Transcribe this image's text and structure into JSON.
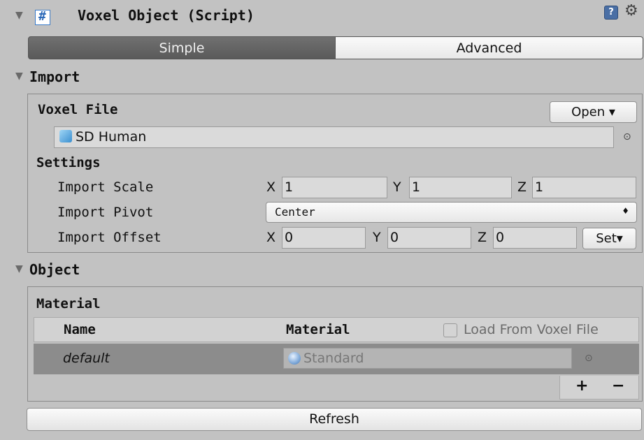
{
  "header": {
    "title": "Voxel Object (Script)",
    "collapse_glyph": "▼",
    "script_icon": "csharp-script-icon",
    "help_glyph": "?",
    "gear_glyph": "⚙"
  },
  "mode_toggle": {
    "options": [
      "Simple",
      "Advanced"
    ],
    "selected": "Simple"
  },
  "import": {
    "title": "Import",
    "collapse_glyph": "▼",
    "voxel_file": {
      "label": "Voxel File",
      "open_label": "Open ▾",
      "value": "SD Human",
      "picker_glyph": "⊙"
    },
    "settings_label": "Settings",
    "import_scale": {
      "label": "Import Scale",
      "x_label": "X",
      "x": "1",
      "y_label": "Y",
      "y": "1",
      "z_label": "Z",
      "z": "1"
    },
    "import_pivot": {
      "label": "Import Pivot",
      "value": "Center",
      "arrow": "♦"
    },
    "import_offset": {
      "label": "Import Offset",
      "x_label": "X",
      "x": "0",
      "y_label": "Y",
      "y": "0",
      "z_label": "Z",
      "z": "0",
      "set_label": "Set▾"
    }
  },
  "object": {
    "title": "Object",
    "collapse_glyph": "▼",
    "material_label": "Material",
    "table": {
      "columns": [
        "Name",
        "Material"
      ],
      "load_from_voxel_file_label": "Load From Voxel File",
      "rows": [
        {
          "name": "default",
          "material": "Standard",
          "picker_glyph": "⊙"
        }
      ],
      "add_glyph": "+",
      "remove_glyph": "−"
    }
  },
  "refresh_label": "Refresh",
  "colors": {
    "panel_bg": "#c2c2c2",
    "selected_tab": "#5a5a5a",
    "row_highlight": "#8c8c8c"
  }
}
